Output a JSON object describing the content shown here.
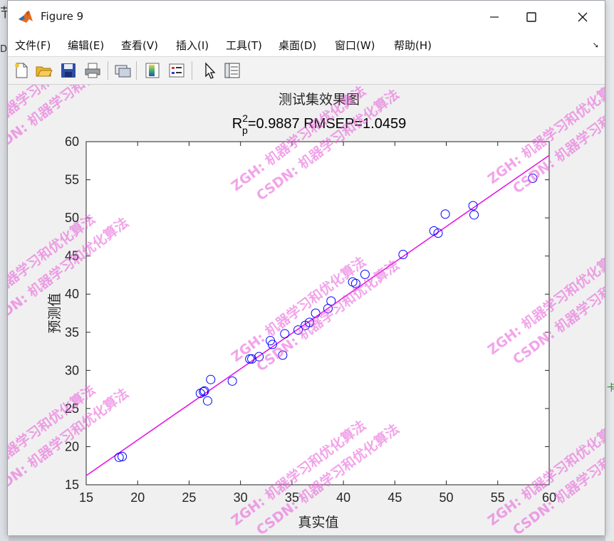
{
  "window": {
    "title": "Figure 9",
    "controls": [
      "minimize",
      "maximize",
      "close"
    ]
  },
  "background": {
    "left_text_top": "节",
    "left_text_mid": "De",
    "right_text": "卡"
  },
  "menu": {
    "items": [
      "文件(F)",
      "编辑(E)",
      "查看(V)",
      "插入(I)",
      "工具(T)",
      "桌面(D)",
      "窗口(W)",
      "帮助(H)"
    ]
  },
  "toolbar": {
    "buttons": [
      "new-figure-icon",
      "open-file-icon",
      "save-icon",
      "print-icon",
      "link-plot-icon",
      "insert-colorbar-icon",
      "insert-legend-icon",
      "edit-plot-icon",
      "property-inspector-icon"
    ]
  },
  "watermark": "ZGH: 机器学习和优化算法 CSDN: 机器学习和优化算法",
  "chart_data": {
    "type": "scatter",
    "title": "测试集效果图",
    "subtitle": "R_p^2=0.9887  RMSEP=1.0459",
    "subtitle_parts": {
      "r": "R",
      "sup": "2",
      "sub": "p",
      "rest": "=0.9887  RMSEP=1.0459"
    },
    "xlabel": "真实值",
    "ylabel": "预测值",
    "xlim": [
      15,
      60
    ],
    "ylim": [
      15,
      60
    ],
    "xticks": [
      15,
      20,
      25,
      30,
      35,
      40,
      45,
      50,
      55,
      60
    ],
    "yticks": [
      15,
      20,
      25,
      30,
      35,
      40,
      45,
      50,
      55,
      60
    ],
    "marker_color": "#0000ff",
    "line_color": "#e619e6",
    "fit_line": {
      "x": [
        15,
        60
      ],
      "y": [
        16.2,
        58.2
      ]
    },
    "series": [
      {
        "marker": "circle",
        "x": [
          18.2,
          18.5,
          26.1,
          26.4,
          26.5,
          26.8,
          27.1,
          29.2,
          30.9,
          31.1,
          31.8,
          32.9,
          33.1,
          34.1,
          34.3,
          35.6,
          36.3,
          36.7,
          37.3,
          38.5,
          38.8,
          40.9,
          41.2,
          42.1,
          45.8,
          48.8,
          49.2,
          49.9,
          52.6,
          52.7,
          58.4
        ],
        "y": [
          18.6,
          18.7,
          27.0,
          27.2,
          27.3,
          26.0,
          28.8,
          28.6,
          31.5,
          31.5,
          31.8,
          33.9,
          33.4,
          32.0,
          34.8,
          35.3,
          35.9,
          36.3,
          37.5,
          38.1,
          39.1,
          41.6,
          41.4,
          42.6,
          45.2,
          48.3,
          48.0,
          50.5,
          51.6,
          50.4,
          55.2
        ]
      }
    ]
  }
}
